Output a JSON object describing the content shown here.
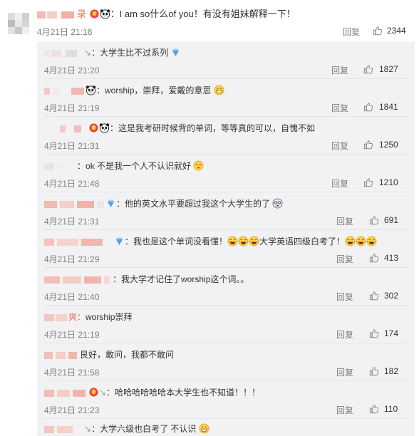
{
  "top_comment": {
    "name_suffix": "录",
    "text": "I am so什么of you！有没有姐妹解释一下！",
    "time": "4月21日 21:18",
    "reply_label": "回复",
    "likes": "2344"
  },
  "replies": [
    {
      "text": "大学生比不过系列",
      "time": "4月21日 21:20",
      "reply_label": "回复",
      "likes": "1827"
    },
    {
      "text": "worship，崇拜，爱戴的意思",
      "time": "4月21日 21:19",
      "reply_label": "回复",
      "likes": "1841"
    },
    {
      "text": "这是我考研时候背的单词，等等真的可以，自愧不如",
      "time": "4月21日 21:31",
      "reply_label": "回复",
      "likes": "1250"
    },
    {
      "text": "ok 不是我一个人不认识就好",
      "time": "4月21日 21:48",
      "reply_label": "回复",
      "likes": "1210"
    },
    {
      "text": "他的英文水平要超过我这个大学生的了",
      "time": "4月21日 21:31",
      "reply_label": "回复",
      "likes": "691"
    },
    {
      "text": "我也是这个单词没看懂！",
      "text2": "大学英语四级白考了！",
      "time": "4月21日 21:29",
      "reply_label": "回复",
      "likes": "413"
    },
    {
      "text": "我大学才记住了worship这个词。。",
      "time": "4月21日 21:40",
      "reply_label": "回复",
      "likes": "302"
    },
    {
      "text": "worship崇拜",
      "name_suffix": "爽：",
      "time": "4月21日 21:19",
      "reply_label": "回复",
      "likes": "174"
    },
    {
      "text": "艮好，敢问，我都不敢问",
      "time": "4月21日 21:58",
      "reply_label": "回复",
      "likes": "182"
    },
    {
      "text": "哈哈哈哈哈哈本大学生也不知道！！！",
      "time": "4月21日 21:23",
      "reply_label": "回复",
      "likes": "110"
    },
    {
      "text": "大学六级也白考了 不认识",
      "time": "",
      "reply_label": "",
      "likes": ""
    }
  ],
  "icons": {
    "like": "thumbs-up-icon",
    "emoji_panda": "panda-icon",
    "emoji_grin": "grin-icon",
    "emoji_laugh_cry": "laugh-cry-icon"
  },
  "colors": {
    "reply_bg": "#f2f2f5",
    "meta_gray": "#808080",
    "text": "#333333"
  }
}
